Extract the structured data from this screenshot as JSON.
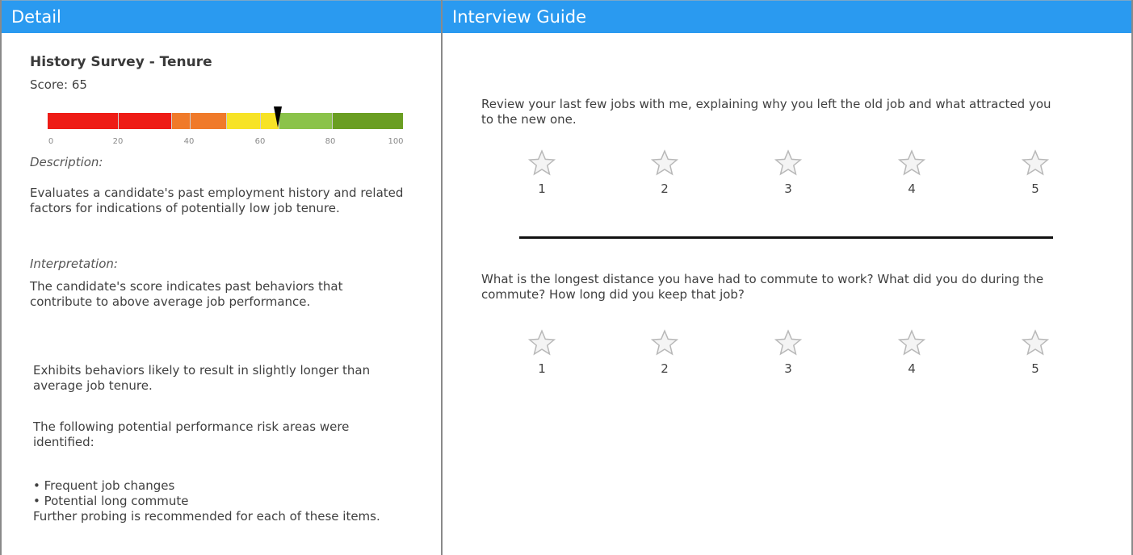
{
  "detail": {
    "header": "Detail",
    "survey_title": "History Survey - Tenure",
    "score_text": "Score: 65",
    "score_value": 65,
    "gauge": {
      "ticks": [
        "0",
        "20",
        "40",
        "60",
        "80",
        "100"
      ],
      "segment_colors": [
        "#ee1c16",
        "#ee1c16",
        "#f07a2a",
        "#f07a2a",
        "#f7e326",
        "#f7e326",
        "#8bc34a",
        "#6a9e22"
      ]
    },
    "description_label": "Description:",
    "description_text": "Evaluates a candidate's past employment history and related factors for indications of potentially low job tenure.",
    "interpretation_label": "Interpretation:",
    "interpretation_text": "The candidate's score indicates past behaviors that contribute to above average job performance.",
    "tenure_text": "Exhibits behaviors likely to result in slightly longer than average job tenure.",
    "risk_intro": "The following potential performance risk areas were identified:",
    "risk_items": [
      "• Frequent job changes",
      "• Potential long commute"
    ],
    "probing_text": "Further probing is recommended for each of these items."
  },
  "interview": {
    "header": "Interview Guide",
    "questions": [
      {
        "text": "Review your last few jobs with me, explaining why you left the old job and what attracted you to the new one.",
        "ratings": [
          "1",
          "2",
          "3",
          "4",
          "5"
        ]
      },
      {
        "text": "What is the longest distance you have had to commute to work? What did you do during the commute? How long did you keep that job?",
        "ratings": [
          "1",
          "2",
          "3",
          "4",
          "5"
        ]
      }
    ]
  }
}
